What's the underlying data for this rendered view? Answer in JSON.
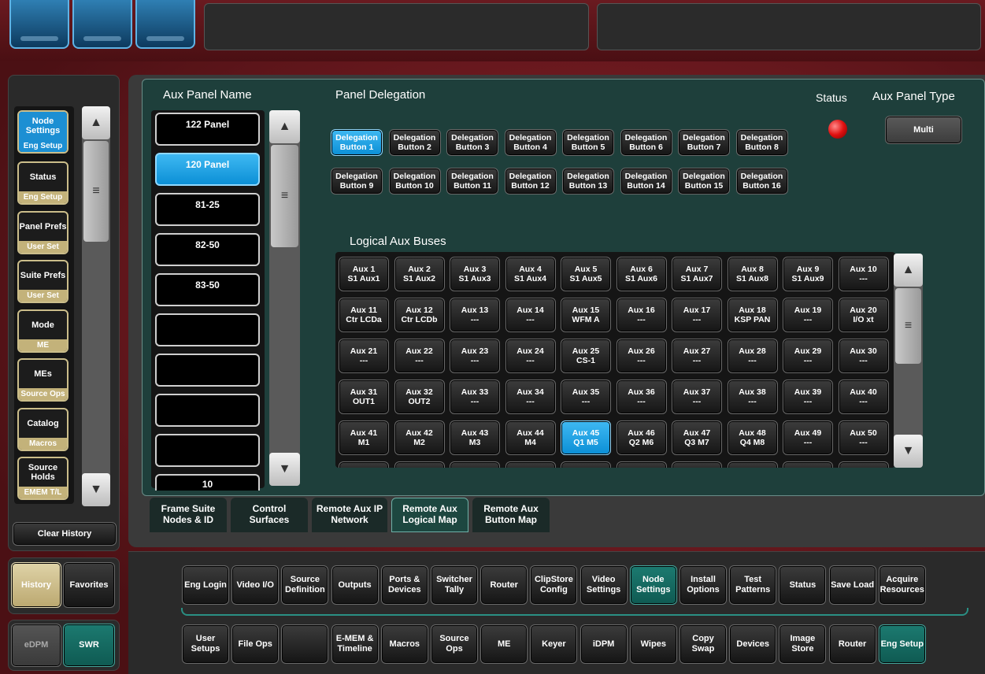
{
  "left_nav": [
    {
      "title": "Node Settings",
      "sub": "Eng Setup",
      "active": true
    },
    {
      "title": "Status",
      "sub": "Eng Setup",
      "active": false
    },
    {
      "title": "Panel Prefs",
      "sub": "User Set",
      "active": false
    },
    {
      "title": "Suite Prefs",
      "sub": "User Set",
      "active": false
    },
    {
      "title": "Mode",
      "sub": "ME",
      "active": false
    },
    {
      "title": "MEs",
      "sub": "Source Ops",
      "active": false
    },
    {
      "title": "Catalog",
      "sub": "Macros",
      "active": false
    },
    {
      "title": "Source Holds",
      "sub": "EMEM T/L",
      "active": false
    }
  ],
  "clear_history": "Clear History",
  "history_label": "History",
  "favorites_label": "Favorites",
  "edpm_label": "eDPM",
  "swr_label": "SWR",
  "headers": {
    "aux_panel_name": "Aux Panel Name",
    "panel_delegation": "Panel Delegation",
    "status": "Status",
    "aux_panel_type": "Aux Panel Type",
    "logical_aux_buses": "Logical Aux Buses"
  },
  "aux_panel_type_value": "Multi",
  "panel_names": [
    "122 Panel",
    "120 Panel",
    "81-25",
    "82-50",
    "83-50",
    "",
    "",
    "",
    "",
    "10"
  ],
  "delegation_buttons": [
    "Delegation Button 1",
    "Delegation Button 2",
    "Delegation Button 3",
    "Delegation Button 4",
    "Delegation Button 5",
    "Delegation Button 6",
    "Delegation Button 7",
    "Delegation Button 8",
    "Delegation Button 9",
    "Delegation Button 10",
    "Delegation Button 11",
    "Delegation Button 12",
    "Delegation Button 13",
    "Delegation Button 14",
    "Delegation Button 15",
    "Delegation Button 16"
  ],
  "aux_buses": [
    [
      "Aux 1",
      "S1 Aux1"
    ],
    [
      "Aux 2",
      "S1 Aux2"
    ],
    [
      "Aux 3",
      "S1 Aux3"
    ],
    [
      "Aux 4",
      "S1 Aux4"
    ],
    [
      "Aux 5",
      "S1 Aux5"
    ],
    [
      "Aux 6",
      "S1 Aux6"
    ],
    [
      "Aux 7",
      "S1 Aux7"
    ],
    [
      "Aux 8",
      "S1 Aux8"
    ],
    [
      "Aux 9",
      "S1 Aux9"
    ],
    [
      "Aux 10",
      "---"
    ],
    [
      "Aux 11",
      "Ctr LCDa"
    ],
    [
      "Aux 12",
      "Ctr LCDb"
    ],
    [
      "Aux 13",
      "---"
    ],
    [
      "Aux 14",
      "---"
    ],
    [
      "Aux 15",
      "WFM A"
    ],
    [
      "Aux 16",
      "---"
    ],
    [
      "Aux 17",
      "---"
    ],
    [
      "Aux 18",
      "KSP PAN"
    ],
    [
      "Aux 19",
      "---"
    ],
    [
      "Aux 20",
      "I/O xt"
    ],
    [
      "Aux 21",
      "---"
    ],
    [
      "Aux 22",
      "---"
    ],
    [
      "Aux 23",
      "---"
    ],
    [
      "Aux 24",
      "---"
    ],
    [
      "Aux 25",
      "CS-1"
    ],
    [
      "Aux 26",
      "---"
    ],
    [
      "Aux 27",
      "---"
    ],
    [
      "Aux 28",
      "---"
    ],
    [
      "Aux 29",
      "---"
    ],
    [
      "Aux 30",
      "---"
    ],
    [
      "Aux 31",
      "OUT1"
    ],
    [
      "Aux 32",
      "OUT2"
    ],
    [
      "Aux 33",
      "---"
    ],
    [
      "Aux 34",
      "---"
    ],
    [
      "Aux 35",
      "---"
    ],
    [
      "Aux 36",
      "---"
    ],
    [
      "Aux 37",
      "---"
    ],
    [
      "Aux 38",
      "---"
    ],
    [
      "Aux 39",
      "---"
    ],
    [
      "Aux 40",
      "---"
    ],
    [
      "Aux 41",
      "M1"
    ],
    [
      "Aux 42",
      "M2"
    ],
    [
      "Aux 43",
      "M3"
    ],
    [
      "Aux 44",
      "M4"
    ],
    [
      "Aux 45",
      "Q1 M5"
    ],
    [
      "Aux 46",
      "Q2 M6"
    ],
    [
      "Aux 47",
      "Q3 M7"
    ],
    [
      "Aux 48",
      "Q4 M8"
    ],
    [
      "Aux 49",
      "---"
    ],
    [
      "Aux 50",
      "---"
    ]
  ],
  "tabs": [
    "Frame Suite Nodes & ID",
    "Control Surfaces",
    "Remote Aux IP Network",
    "Remote Aux Logical Map",
    "Remote Aux Button Map"
  ],
  "menu_row1": [
    "Eng Login",
    "Video I/O",
    "Source Definition",
    "Outputs",
    "Ports & Devices",
    "Switcher Tally",
    "Router",
    "ClipStore Config",
    "Video Settings",
    "Node Settings",
    "Install Options",
    "Test Patterns",
    "Status",
    "Save Load",
    "Acquire Resources"
  ],
  "menu_row2": [
    "User Setups",
    "File Ops",
    "",
    "E-MEM & Timeline",
    "Macros",
    "Source Ops",
    "ME",
    "Keyer",
    "iDPM",
    "Wipes",
    "Copy Swap",
    "Devices",
    "Image Store",
    "Router",
    "Eng Setup"
  ],
  "colors": {
    "accent_blue": "#1c8fd3",
    "teal": "#1d6b63",
    "status_red": "#e01010"
  }
}
